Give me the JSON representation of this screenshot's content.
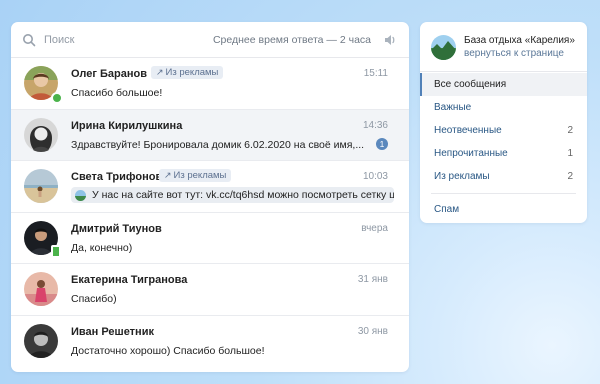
{
  "search": {
    "placeholder": "Поиск",
    "avg_response": "Среднее время ответа — 2 часа"
  },
  "chats": [
    {
      "name": "Олег Баранов",
      "badge": "Из рекламы",
      "time": "15:11",
      "message": "Спасибо большое!",
      "unread": 0,
      "status": "online"
    },
    {
      "name": "Ирина Кирилушкина",
      "badge": "",
      "time": "14:36",
      "message": "Здравствуйте! Бронировала домик 6.02.2020 на своё имя,...",
      "unread": 1,
      "status": ""
    },
    {
      "name": "Света Трифонова",
      "badge": "Из рекламы",
      "time": "10:03",
      "message": "У нас на сайте вот тут: vk.cc/tq6hsd можно посмотреть сетку ц...",
      "unread": 0,
      "status": ""
    },
    {
      "name": "Дмитрий Тиунов",
      "badge": "",
      "time": "вчера",
      "message": "Да, конечно)",
      "unread": 0,
      "status": "mobile"
    },
    {
      "name": "Екатерина Тигранова",
      "badge": "",
      "time": "31 янв",
      "message": "Спасибо)",
      "unread": 0,
      "status": ""
    },
    {
      "name": "Иван Решетник",
      "badge": "",
      "time": "30 янв",
      "message": "Достаточно хорошо) Спасибо большое!",
      "unread": 0,
      "status": ""
    }
  ],
  "group": {
    "title": "База отдыха «Карелия»",
    "back_link": "вернуться к странице"
  },
  "filters": [
    {
      "label": "Все сообщения",
      "count": "",
      "active": true
    },
    {
      "label": "Важные",
      "count": ""
    },
    {
      "label": "Неотвеченные",
      "count": "2"
    },
    {
      "label": "Непрочитанные",
      "count": "1"
    },
    {
      "label": "Из рекламы",
      "count": "2"
    }
  ],
  "spam_label": "Спам",
  "colors": {
    "accent": "#5181b8",
    "link": "#2a5885",
    "online": "#4bb34b",
    "badge_bg": "#e8edf4"
  }
}
